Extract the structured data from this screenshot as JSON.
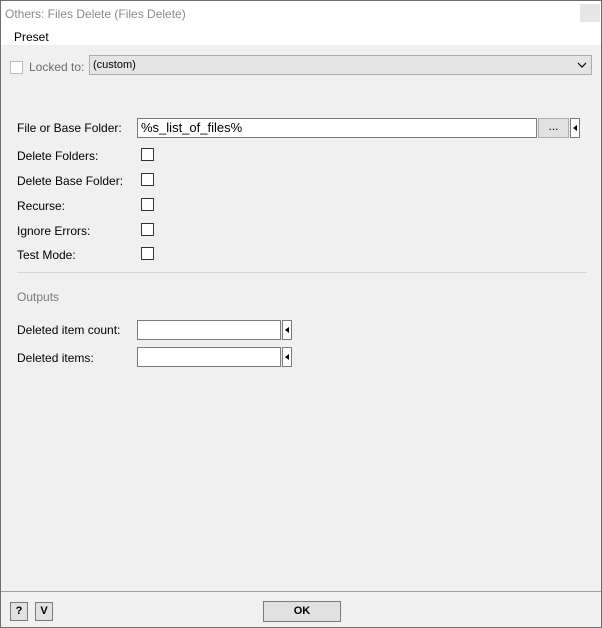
{
  "window": {
    "title": "Others: Files Delete (Files Delete)"
  },
  "menu": {
    "preset": "Preset"
  },
  "lock": {
    "label": "Locked to:",
    "value": "(custom)"
  },
  "fields": {
    "file_label": "File or Base Folder:",
    "file_value": "%s_list_of_files%",
    "browse_label": "...",
    "delete_folders": "Delete Folders:",
    "delete_base_folder": "Delete Base Folder:",
    "recurse": "Recurse:",
    "ignore_errors": "Ignore Errors:",
    "test_mode": "Test Mode:"
  },
  "outputs": {
    "heading": "Outputs",
    "deleted_count_label": "Deleted item count:",
    "deleted_count_value": "",
    "deleted_items_label": "Deleted items:",
    "deleted_items_value": ""
  },
  "footer": {
    "help": "?",
    "v": "V",
    "ok": "OK"
  }
}
